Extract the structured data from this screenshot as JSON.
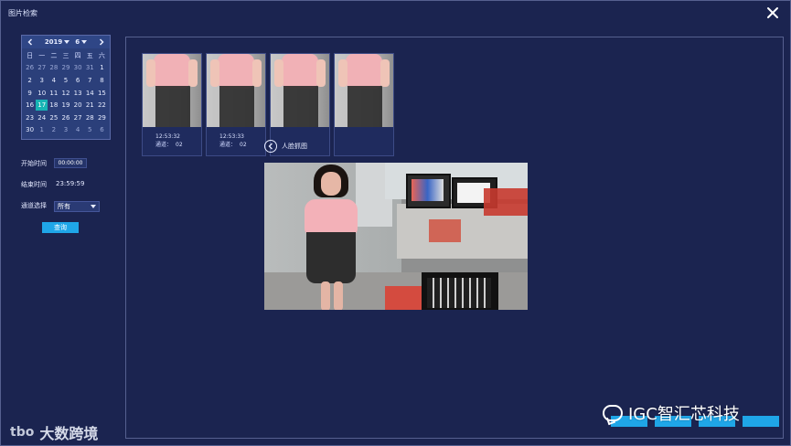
{
  "window": {
    "title": "图片检索"
  },
  "calendar": {
    "year": "2019",
    "month": "6",
    "weekdays": [
      "日",
      "一",
      "二",
      "三",
      "四",
      "五",
      "六"
    ],
    "weeks": [
      [
        "26",
        "27",
        "28",
        "29",
        "30",
        "31",
        "1"
      ],
      [
        "2",
        "3",
        "4",
        "5",
        "6",
        "7",
        "8"
      ],
      [
        "9",
        "10",
        "11",
        "12",
        "13",
        "14",
        "15"
      ],
      [
        "16",
        "17",
        "18",
        "19",
        "20",
        "21",
        "22"
      ],
      [
        "23",
        "24",
        "25",
        "26",
        "27",
        "28",
        "29"
      ],
      [
        "30",
        "1",
        "2",
        "3",
        "4",
        "5",
        "6"
      ]
    ],
    "selected_day": "17",
    "selected_color": "#17b4b4"
  },
  "form": {
    "start_label": "开始时间",
    "start_value": "00:00:00",
    "end_label": "结束时间",
    "end_value": "23:59:59",
    "channel_label": "通道选择",
    "channel_value": "所有",
    "query_label": "查询"
  },
  "thumbs": [
    {
      "time": "12:53:32",
      "channel_label": "通道：",
      "channel": "02"
    },
    {
      "time": "12:53:33",
      "channel_label": "通道：",
      "channel": "02"
    },
    {
      "time": "",
      "channel_label": "",
      "channel": ""
    },
    {
      "time": "",
      "channel_label": "",
      "channel": ""
    }
  ],
  "detail": {
    "back_text": "人脸抓图"
  },
  "actions": {
    "buttons": [
      "",
      "",
      "",
      ""
    ]
  },
  "watermarks": {
    "right": "IGC智汇芯科技",
    "left": "大数跨境",
    "left_logo": "tbo"
  },
  "colors": {
    "background": "#1b2450",
    "panel_border": "#56608f",
    "accent": "#1fa6e8"
  },
  "icons": {
    "close": "close-icon",
    "back": "back-arrow-icon",
    "prev": "chevron-left-icon",
    "next": "chevron-right-icon"
  }
}
